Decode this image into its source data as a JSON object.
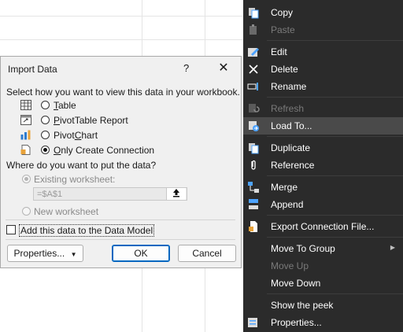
{
  "dialog": {
    "title": "Import Data",
    "help": "?",
    "close": "✕",
    "prompt": "Select how you want to view this data in your workbook.",
    "options": [
      {
        "pre": "",
        "u": "T",
        "post": "able",
        "checked": false
      },
      {
        "pre": "",
        "u": "P",
        "post": "ivotTable Report",
        "checked": false
      },
      {
        "pre": "Pivot",
        "u": "C",
        "post": "hart",
        "checked": false
      },
      {
        "pre": "",
        "u": "O",
        "post": "nly Create Connection",
        "checked": true
      }
    ],
    "put_prompt": "Where do you want to put the data?",
    "existing_label": "Existing worksheet:",
    "existing_value": "=$A$1",
    "new_label": "New worksheet",
    "data_model_label": "Add this data to the Data Model",
    "properties_button": "Properties...",
    "ok_button": "OK",
    "cancel_button": "Cancel"
  },
  "menu": {
    "items": [
      {
        "label": "Copy",
        "icon": "copy-icon",
        "disabled": false
      },
      {
        "label": "Paste",
        "icon": "paste-icon",
        "disabled": true
      },
      {
        "label": "Edit",
        "icon": "edit-icon",
        "disabled": false
      },
      {
        "label": "Delete",
        "icon": "delete-icon",
        "disabled": false
      },
      {
        "label": "Rename",
        "icon": "rename-icon",
        "disabled": false
      },
      {
        "label": "Refresh",
        "icon": "refresh-icon",
        "disabled": true
      },
      {
        "label": "Load To...",
        "icon": "load-to-icon",
        "disabled": false,
        "hover": true
      },
      {
        "label": "Duplicate",
        "icon": "duplicate-icon",
        "disabled": false
      },
      {
        "label": "Reference",
        "icon": "reference-icon",
        "disabled": false
      },
      {
        "label": "Merge",
        "icon": "merge-icon",
        "disabled": false
      },
      {
        "label": "Append",
        "icon": "append-icon",
        "disabled": false
      },
      {
        "label": "Export Connection File...",
        "icon": "export-icon",
        "disabled": false
      },
      {
        "label": "Move To Group",
        "icon": "",
        "disabled": false,
        "submenu": true
      },
      {
        "label": "Move Up",
        "icon": "",
        "disabled": true
      },
      {
        "label": "Move Down",
        "icon": "",
        "disabled": false
      },
      {
        "label": "Show the peek",
        "icon": "",
        "disabled": false
      },
      {
        "label": "Properties...",
        "icon": "properties-icon",
        "disabled": false
      }
    ]
  },
  "colors": {
    "menu_bg": "#2b2b2b",
    "menu_hover": "#4a4a4a",
    "accent": "#0067c0"
  }
}
